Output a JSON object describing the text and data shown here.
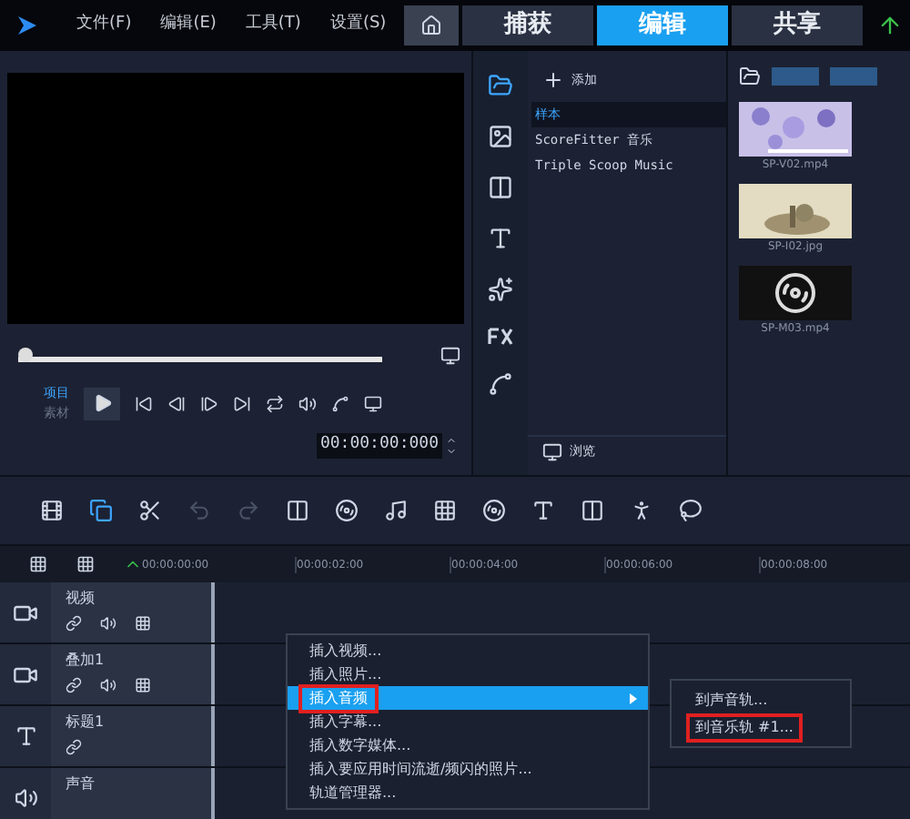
{
  "menu_bar": [
    "文件(F)",
    "编辑(E)",
    "工具(T)",
    "设置(S)"
  ],
  "workspace_tabs": [
    {
      "label": "捕获",
      "selected": false
    },
    {
      "label": "编辑",
      "selected": true
    },
    {
      "label": "共享",
      "selected": false
    }
  ],
  "player": {
    "modes": [
      {
        "label": "项目",
        "selected": true
      },
      {
        "label": "素材",
        "selected": false
      }
    ],
    "level": 0.02,
    "timecode": "00:00:00:000"
  },
  "library": {
    "add_label": "添加",
    "folders": [
      {
        "label": "样本",
        "selected": true
      },
      {
        "label": "ScoreFitter 音乐",
        "selected": false
      },
      {
        "label": "Triple Scoop Music",
        "selected": false
      }
    ],
    "browse_label": "浏览",
    "media": [
      {
        "name": "SP-V02.mp4",
        "kind": "video"
      },
      {
        "name": "SP-I02.jpg"
      },
      {
        "name": "SP-M03.mp4",
        "kind": "audio"
      }
    ]
  },
  "timeline": {
    "ticks": [
      "00:00:00:00",
      "00:00:02:00",
      "00:00:04:00",
      "00:00:06:00",
      "00:00:08:00"
    ],
    "tracks": [
      {
        "name": "视频",
        "kind": "video"
      },
      {
        "name": "叠加1",
        "kind": "overlay"
      },
      {
        "name": "标题1",
        "kind": "title"
      },
      {
        "name": "声音",
        "kind": "voice"
      }
    ]
  },
  "context_menu": [
    {
      "label": "插入视频...",
      "selected": false,
      "annotated": false
    },
    {
      "label": "插入照片...",
      "selected": false,
      "annotated": false
    },
    {
      "label": "插入音频",
      "selected": true,
      "annotated": true,
      "submenu": [
        {
          "label": "到声音轨...",
          "annotated": false
        },
        {
          "label": "到音乐轨 #1...",
          "annotated": true
        }
      ]
    },
    {
      "label": "插入字幕...",
      "selected": false,
      "annotated": false
    },
    {
      "label": "插入数字媒体...",
      "selected": false,
      "annotated": false
    },
    {
      "label": "插入要应用时间流逝/频闪的照片...",
      "selected": false,
      "annotated": false
    },
    {
      "label": "轨道管理器...",
      "selected": false,
      "annotated": false
    }
  ]
}
